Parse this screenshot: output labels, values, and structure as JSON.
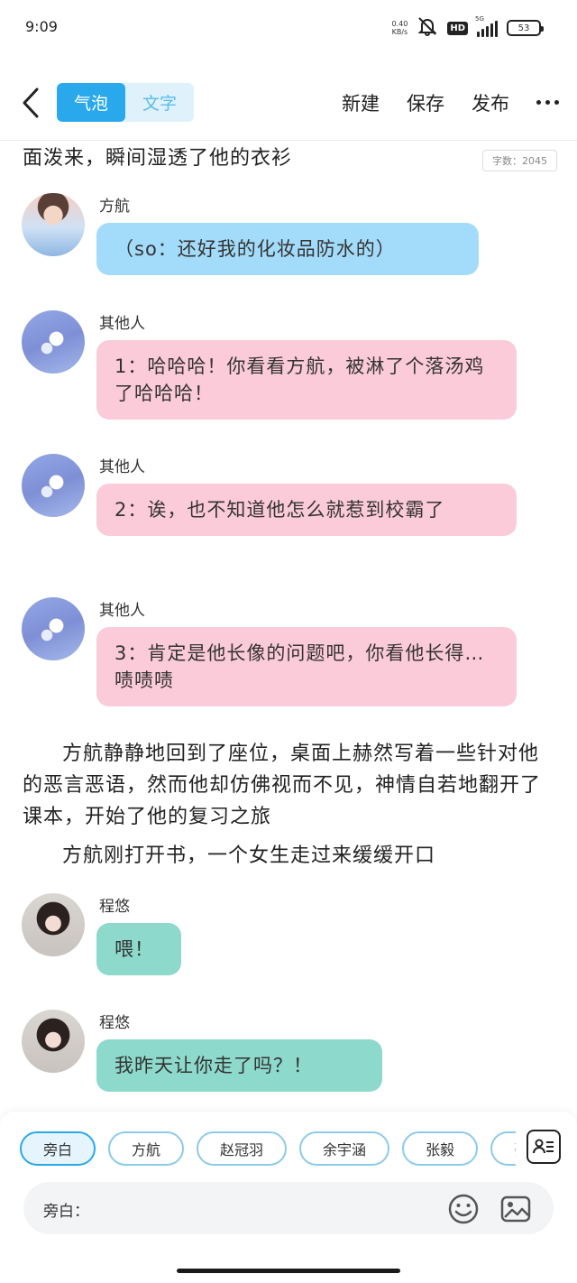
{
  "status_bar": {
    "time": "9:09",
    "net_speed_value": "0.40",
    "net_speed_unit": "KB/s",
    "hd_badge": "HD",
    "signal_label": "5G",
    "battery_level": "53"
  },
  "header": {
    "tabs": [
      {
        "label": "气泡",
        "active": true
      },
      {
        "label": "文字",
        "active": false
      }
    ],
    "new_label": "新建",
    "save_label": "保存",
    "publish_label": "发布"
  },
  "content": {
    "word_count_label": "字数：",
    "word_count_value": "2045",
    "top_fragment": "面泼来，瞬间湿透了他的衣衫",
    "messages": [
      {
        "sender": "方航",
        "avatar": "avatar-boy",
        "color": "blue",
        "text": "（so：还好我的化妆品防水的）"
      },
      {
        "sender": "其他人",
        "avatar": "avatar-other",
        "color": "pink",
        "text": "1：哈哈哈！你看看方航，被淋了个落汤鸡了哈哈哈！"
      },
      {
        "sender": "其他人",
        "avatar": "avatar-other",
        "color": "pink",
        "text": "2：诶，也不知道他怎么就惹到校霸了"
      },
      {
        "sender": "其他人",
        "avatar": "avatar-other",
        "color": "pink",
        "text": "3：肯定是他长像的问题吧，你看他长得…啧啧啧"
      },
      {
        "sender": "程悠",
        "avatar": "avatar-girl",
        "color": "teal",
        "text": "喂！"
      },
      {
        "sender": "程悠",
        "avatar": "avatar-girl",
        "color": "teal",
        "text": "我昨天让你走了吗？！"
      }
    ],
    "paragraphs": [
      "方航静静地回到了座位，桌面上赫然写着一些针对他的恶言恶语，然而他却仿佛视而不见，神情自若地翻开了课本，开始了他的复习之旅",
      "方航刚打开书，一个女生走过来缓缓开口"
    ]
  },
  "bottom": {
    "roles": [
      "旁白",
      "方航",
      "赵冠羽",
      "余宇涵",
      "张毅",
      "张泽"
    ],
    "input_label": "旁白：",
    "input_value": "",
    "input_placeholder": ""
  },
  "colors": {
    "accent": "#2aa8ec",
    "bubble_blue": "#a3dcfa",
    "bubble_pink": "#fccbd9",
    "bubble_teal": "#8dd9cc"
  }
}
